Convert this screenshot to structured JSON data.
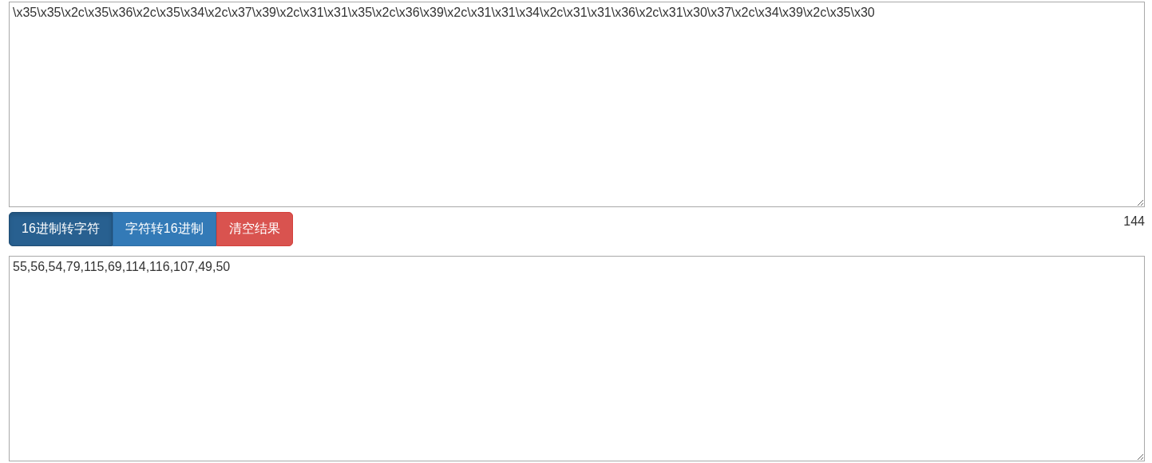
{
  "input_box": {
    "value": "\\x35\\x35\\x2c\\x35\\x36\\x2c\\x35\\x34\\x2c\\x37\\x39\\x2c\\x31\\x31\\x35\\x2c\\x36\\x39\\x2c\\x31\\x31\\x34\\x2c\\x31\\x31\\x36\\x2c\\x31\\x30\\x37\\x2c\\x34\\x39\\x2c\\x35\\x30"
  },
  "buttons": [
    {
      "label": "16进制转字符",
      "kind": "primary",
      "selected": true
    },
    {
      "label": "字符转16进制",
      "kind": "primary",
      "selected": false
    },
    {
      "label": "清空结果",
      "kind": "danger",
      "selected": false
    }
  ],
  "count": "144",
  "output_box": {
    "value": "55,56,54,79,115,69,114,116,107,49,50"
  }
}
